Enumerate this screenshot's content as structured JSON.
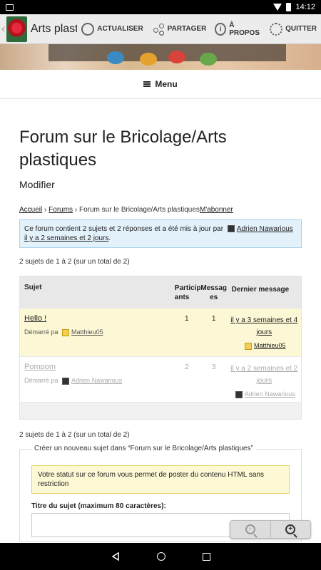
{
  "status_bar": {
    "time": "14:12"
  },
  "app_bar": {
    "title": "Arts plastiq..",
    "buttons": [
      {
        "label": "ACTUALISER",
        "icon": "refresh-icon"
      },
      {
        "label": "PARTAGER",
        "icon": "share-icon"
      },
      {
        "label": "À PROPOS",
        "icon": "info-icon"
      },
      {
        "label": "QUITTER",
        "icon": "power-icon"
      }
    ]
  },
  "menu": {
    "label": "Menu"
  },
  "page": {
    "title": "Forum sur le Bricolage/Arts plastiques",
    "edit": "Modifier",
    "breadcrumb": {
      "home": "Accueil",
      "sep": "›",
      "forums": "Forums",
      "current": "Forum sur le Bricolage/Arts plastiques",
      "subscribe": "M'abonner"
    },
    "info": {
      "text": "Ce forum contient 2 sujets et 2 réponses et a été mis à jour par",
      "author": "Adrien Nawarious",
      "time": "il y a 2 semaines et 2 jours",
      "end": "."
    },
    "count_top": "2 sujets de 1 à 2 (sur un total de 2)",
    "count_bottom": "2 sujets de 1 à 2 (sur un total de 2)"
  },
  "table": {
    "headers": {
      "subject": "Sujet",
      "participants": "Particip ants",
      "messages": "Messag es",
      "last": "Dernier message"
    },
    "rows": [
      {
        "title": "Hello !",
        "started_label": "Démarré pa",
        "author": "Matthieu05",
        "participants": "1",
        "messages": "1",
        "last_time": "il y a 3 semaines et 4 jours",
        "last_author": "Matthieu05"
      },
      {
        "title": "Pompom",
        "started_label": "Démarré pa",
        "author": "Adrien Nawarious",
        "participants": "2",
        "messages": "3",
        "last_time": "il y a 2 semaines et 2 jours",
        "last_author": "Adrien Nawarious"
      }
    ]
  },
  "new_topic": {
    "legend": "Créer un nouveau sujet dans “Forum sur le Bricolage/Arts plastiques”",
    "notice": "Votre statut sur ce forum vous permet de poster du contenu HTML sans restriction",
    "title_label": "Titre du sujet (maximum 80 caractères):",
    "title_value": ""
  },
  "zoom": {
    "out": "-",
    "in": "+"
  }
}
